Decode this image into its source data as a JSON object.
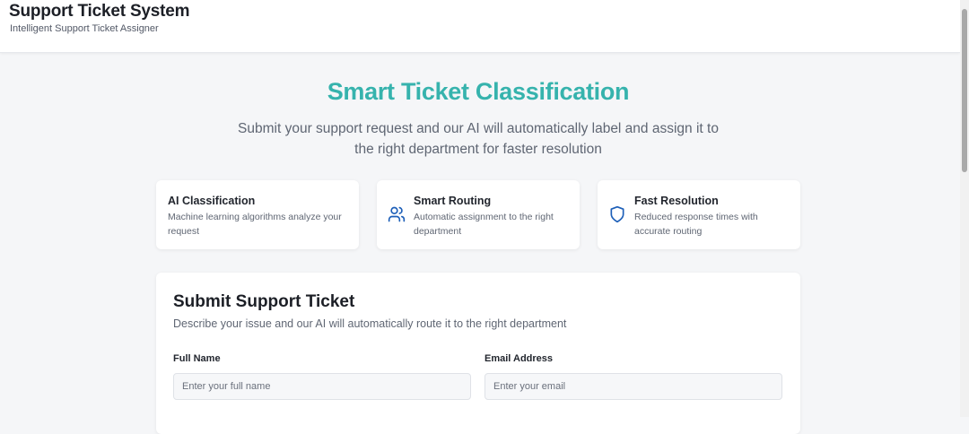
{
  "header": {
    "title": "Support Ticket System",
    "subtitle": "Intelligent Support Ticket Assigner"
  },
  "hero": {
    "title": "Smart Ticket Classification",
    "description": "Submit your support request and our AI will automatically label and assign it to the right department for faster resolution"
  },
  "features": [
    {
      "title": "AI Classification",
      "description": "Machine learning algorithms analyze your request",
      "icon": "none"
    },
    {
      "title": "Smart Routing",
      "description": "Automatic assignment to the right department",
      "icon": "users-icon"
    },
    {
      "title": "Fast Resolution",
      "description": "Reduced response times with accurate routing",
      "icon": "shield-icon"
    }
  ],
  "form": {
    "title": "Submit Support Ticket",
    "description": "Describe your issue and our AI will automatically route it to the right department",
    "fields": [
      {
        "label": "Full Name",
        "value": "",
        "placeholder": "Enter your full name"
      },
      {
        "label": "Email Address",
        "value": "",
        "placeholder": "Enter your email"
      }
    ]
  },
  "colors": {
    "accent": "#36b3ad",
    "icon": "#1d5fb8",
    "background": "#f5f6f8"
  }
}
